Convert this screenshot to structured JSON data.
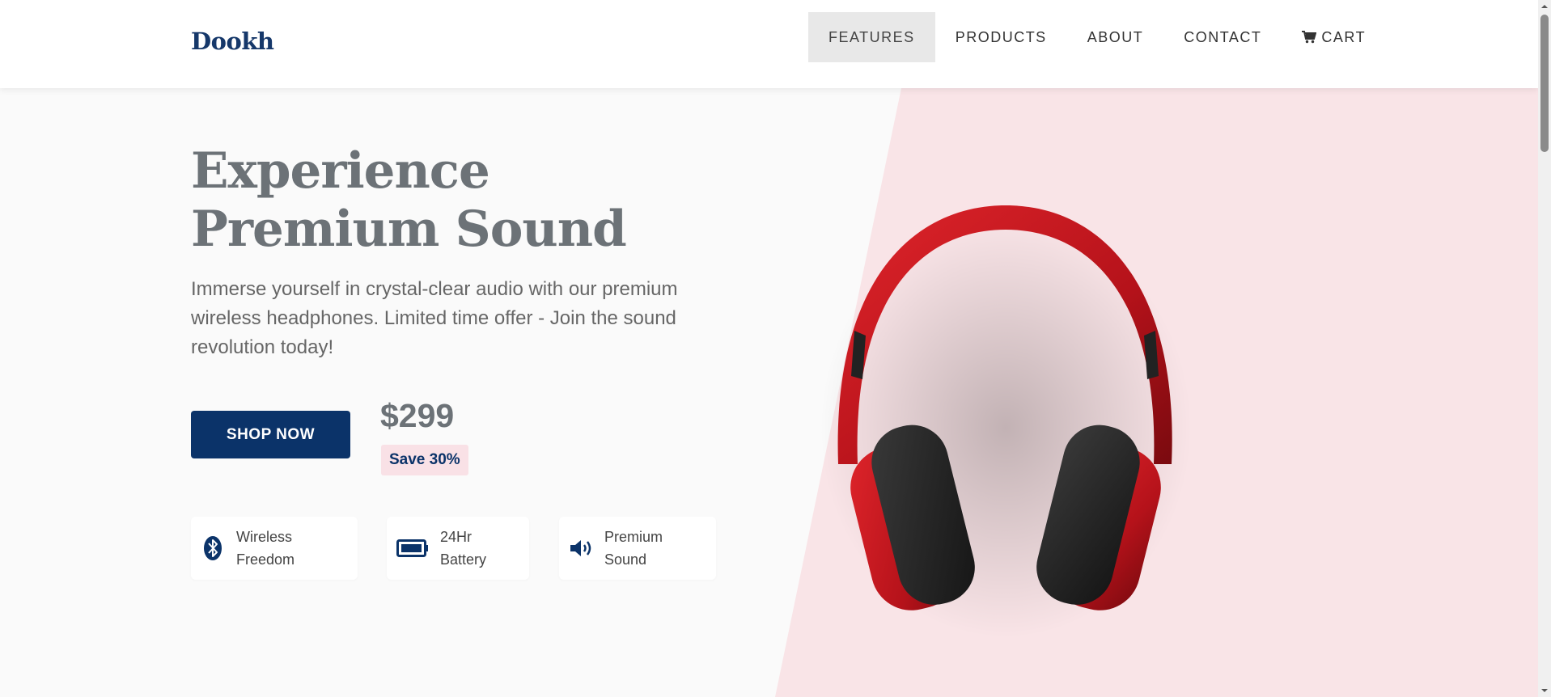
{
  "brand": {
    "name": "Dookh",
    "color": "#16386a"
  },
  "nav": {
    "items": [
      {
        "label": "FEATURES",
        "active": true
      },
      {
        "label": "PRODUCTS",
        "active": false
      },
      {
        "label": "ABOUT",
        "active": false
      },
      {
        "label": "CONTACT",
        "active": false
      },
      {
        "label": "CART",
        "active": false,
        "icon": "cart-icon"
      }
    ]
  },
  "hero": {
    "title": "Experience Premium Sound",
    "subtitle": "Immerse yourself in crystal-clear audio with our premium wireless headphones. Limited time offer - Join the sound revolution today!",
    "cta_label": "SHOP NOW",
    "price": "$299",
    "save_label": "Save 30%",
    "features": [
      {
        "icon": "bluetooth-icon",
        "line1": "Wireless",
        "line2": "Freedom"
      },
      {
        "icon": "battery-icon",
        "line1": "24Hr",
        "line2": "Battery"
      },
      {
        "icon": "volume-icon",
        "line1": "Premium",
        "line2": "Sound"
      }
    ],
    "product_image": "red-headphones"
  },
  "colors": {
    "primary": "#0b3369",
    "accent_pink": "#f9e4e7",
    "title_gray": "#6c7277",
    "headphone_red": "#c0171d"
  }
}
